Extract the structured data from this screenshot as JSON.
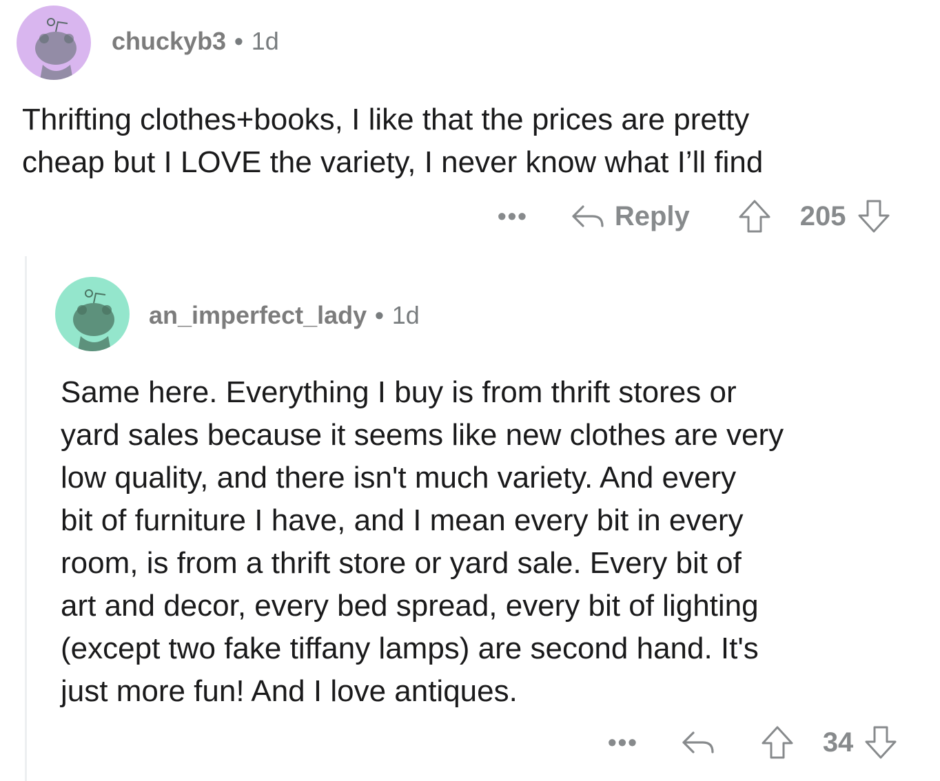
{
  "comments": [
    {
      "username": "chuckyb3",
      "separator": "•",
      "age": "1d",
      "avatar_color": "#d9b6ef",
      "lines": [
        "Thrifting clothes+books, I like that the prices are pretty",
        "cheap but I LOVE the variety, I never know what I’ll find"
      ],
      "more_label": "•••",
      "reply_label": "Reply",
      "score": "205"
    },
    {
      "username": "an_imperfect_lady",
      "separator": "•",
      "age": "1d",
      "avatar_color": "#94e6cc",
      "lines": [
        "Same here. Everything I buy is from thrift stores or",
        "yard sales because it seems like new clothes are very",
        "low quality, and there isn't much variety. And every",
        "bit of furniture I have, and I mean every bit in every",
        "room, is from a thrift store or yard sale. Every bit of",
        "art and decor, every bed spread, every bit of lighting",
        "(except two fake tiffany lamps) are second hand. It's",
        "just more fun! And I love antiques."
      ],
      "more_label": "•••",
      "score": "34"
    }
  ],
  "icons": {
    "avatar": "snoo-avatar-icon",
    "reply": "reply-arrow-icon",
    "upvote": "upvote-arrow-icon",
    "downvote": "downvote-arrow-icon"
  },
  "colors": {
    "meta_gray": "#787c7e",
    "action_gray": "#878a8c",
    "text": "#1a1a1b",
    "thread_line": "#edeff1"
  }
}
